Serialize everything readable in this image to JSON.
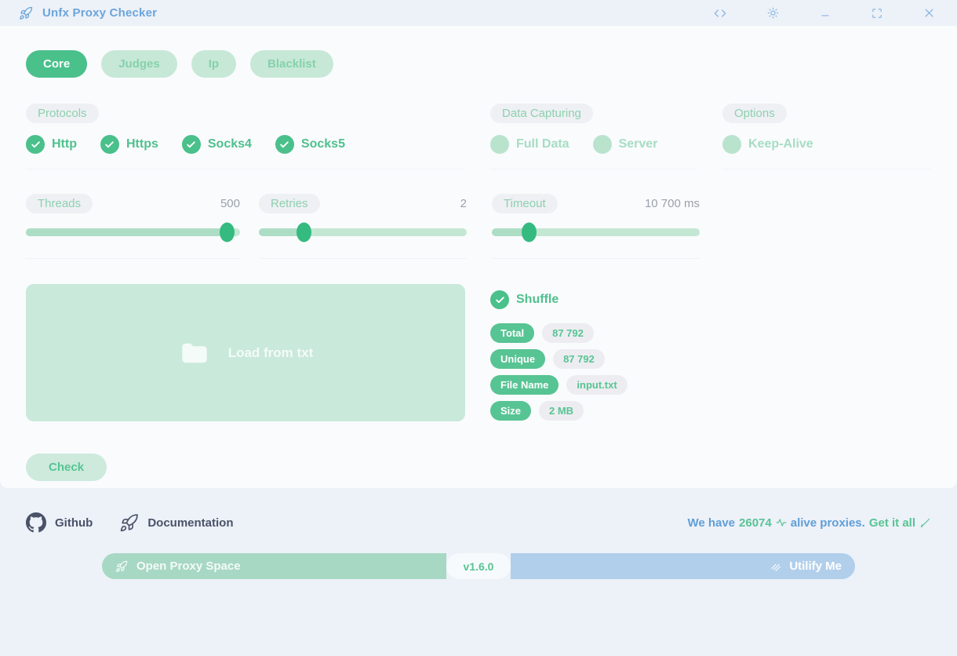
{
  "titlebar": {
    "title": "Unfx Proxy Checker"
  },
  "tabs": [
    {
      "label": "Core"
    },
    {
      "label": "Judges"
    },
    {
      "label": "Ip"
    },
    {
      "label": "Blacklist"
    }
  ],
  "sections": {
    "protocols": {
      "label": "Protocols",
      "items": [
        {
          "label": "Http",
          "checked": true
        },
        {
          "label": "Https",
          "checked": true
        },
        {
          "label": "Socks4",
          "checked": true
        },
        {
          "label": "Socks5",
          "checked": true
        }
      ]
    },
    "data_capturing": {
      "label": "Data Capturing",
      "items": [
        {
          "label": "Full Data",
          "checked": false
        },
        {
          "label": "Server",
          "checked": false
        }
      ]
    },
    "options": {
      "label": "Options",
      "items": [
        {
          "label": "Keep-Alive",
          "checked": false
        }
      ]
    }
  },
  "sliders": [
    {
      "label": "Threads",
      "value": "500",
      "fill": "94%"
    },
    {
      "label": "Retries",
      "value": "2",
      "fill": "22%"
    },
    {
      "label": "Timeout",
      "value": "10 700 ms",
      "fill": "18%"
    }
  ],
  "dropzone": {
    "label": "Load from txt"
  },
  "shuffle": {
    "label": "Shuffle",
    "checked": true
  },
  "stats": [
    {
      "key": "Total",
      "value": "87 792"
    },
    {
      "key": "Unique",
      "value": "87 792"
    },
    {
      "key": "File Name",
      "value": "input.txt"
    },
    {
      "key": "Size",
      "value": "2 MB"
    }
  ],
  "check_button_label": "Check",
  "footer": {
    "github_label": "Github",
    "documentation_label": "Documentation",
    "alive": {
      "prefix": "We have",
      "count": "26074",
      "middle": "alive proxies.",
      "link": "Get it all"
    }
  },
  "bottombar": {
    "left_label": "Open Proxy Space",
    "version": "v1.6.0",
    "right_label": "Utilify Me"
  },
  "colors": {
    "accent_green": "#4ac08b",
    "light_green": "#c9e9da",
    "blue_text": "#5f9fd7",
    "bar_green": "#a7d8c3",
    "bar_blue": "#b1cfeb",
    "footer_bg": "#edf1f8"
  }
}
